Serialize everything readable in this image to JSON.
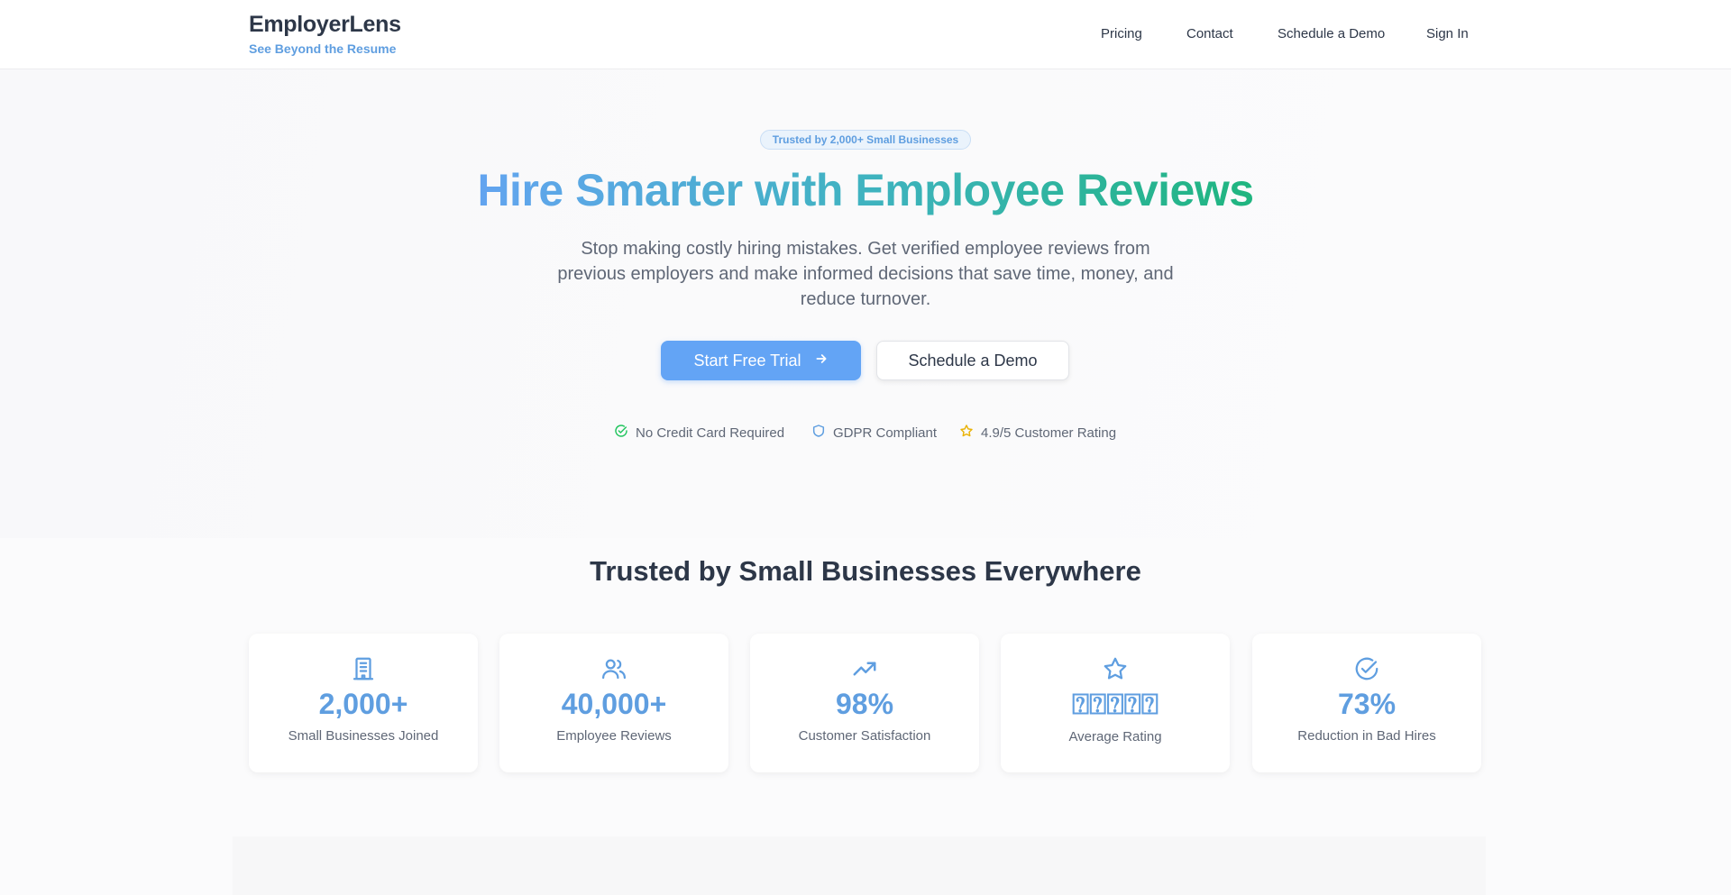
{
  "brand": {
    "name": "EmployerLens",
    "tagline": "See Beyond the Resume"
  },
  "nav": {
    "items": [
      {
        "label": "Pricing"
      },
      {
        "label": "Contact"
      },
      {
        "label": "Schedule a Demo"
      },
      {
        "label": "Sign In"
      }
    ]
  },
  "hero": {
    "badge": "Trusted by 2,000+ Small Businesses",
    "title": "Hire Smarter with Employee Reviews",
    "subtitle": "Stop making costly hiring mistakes. Get verified employee reviews from previous employers and make informed decisions that save time, money, and reduce turnover.",
    "primary_button": "Start Free Trial",
    "secondary_button": "Schedule a Demo",
    "features": [
      {
        "label": "No Credit Card Required",
        "icon": "check-circle-icon",
        "color": "#22c55e"
      },
      {
        "label": "GDPR Compliant",
        "icon": "shield-icon",
        "color": "#5f9ee0"
      },
      {
        "label": "4.9/5 Customer Rating",
        "icon": "star-icon",
        "color": "#eab308"
      }
    ]
  },
  "stats": {
    "title": "Trusted by Small Businesses Everywhere",
    "items": [
      {
        "value": "2,000+",
        "label": "Small Businesses Joined",
        "icon": "building-icon"
      },
      {
        "value": "40,000+",
        "label": "Employee Reviews",
        "icon": "users-icon"
      },
      {
        "value": "98%",
        "label": "Customer Satisfaction",
        "icon": "trending-up-icon"
      },
      {
        "value": "⍰⍰⍰⍰⍰",
        "label": "Average Rating",
        "icon": "star-icon"
      },
      {
        "value": "73%",
        "label": "Reduction in Bad Hires",
        "icon": "check-circle-icon"
      }
    ]
  },
  "colors": {
    "accent": "#5f9ee0",
    "primary_button": "#63a4f5",
    "text": "#2d3748",
    "muted": "#5f6776"
  }
}
